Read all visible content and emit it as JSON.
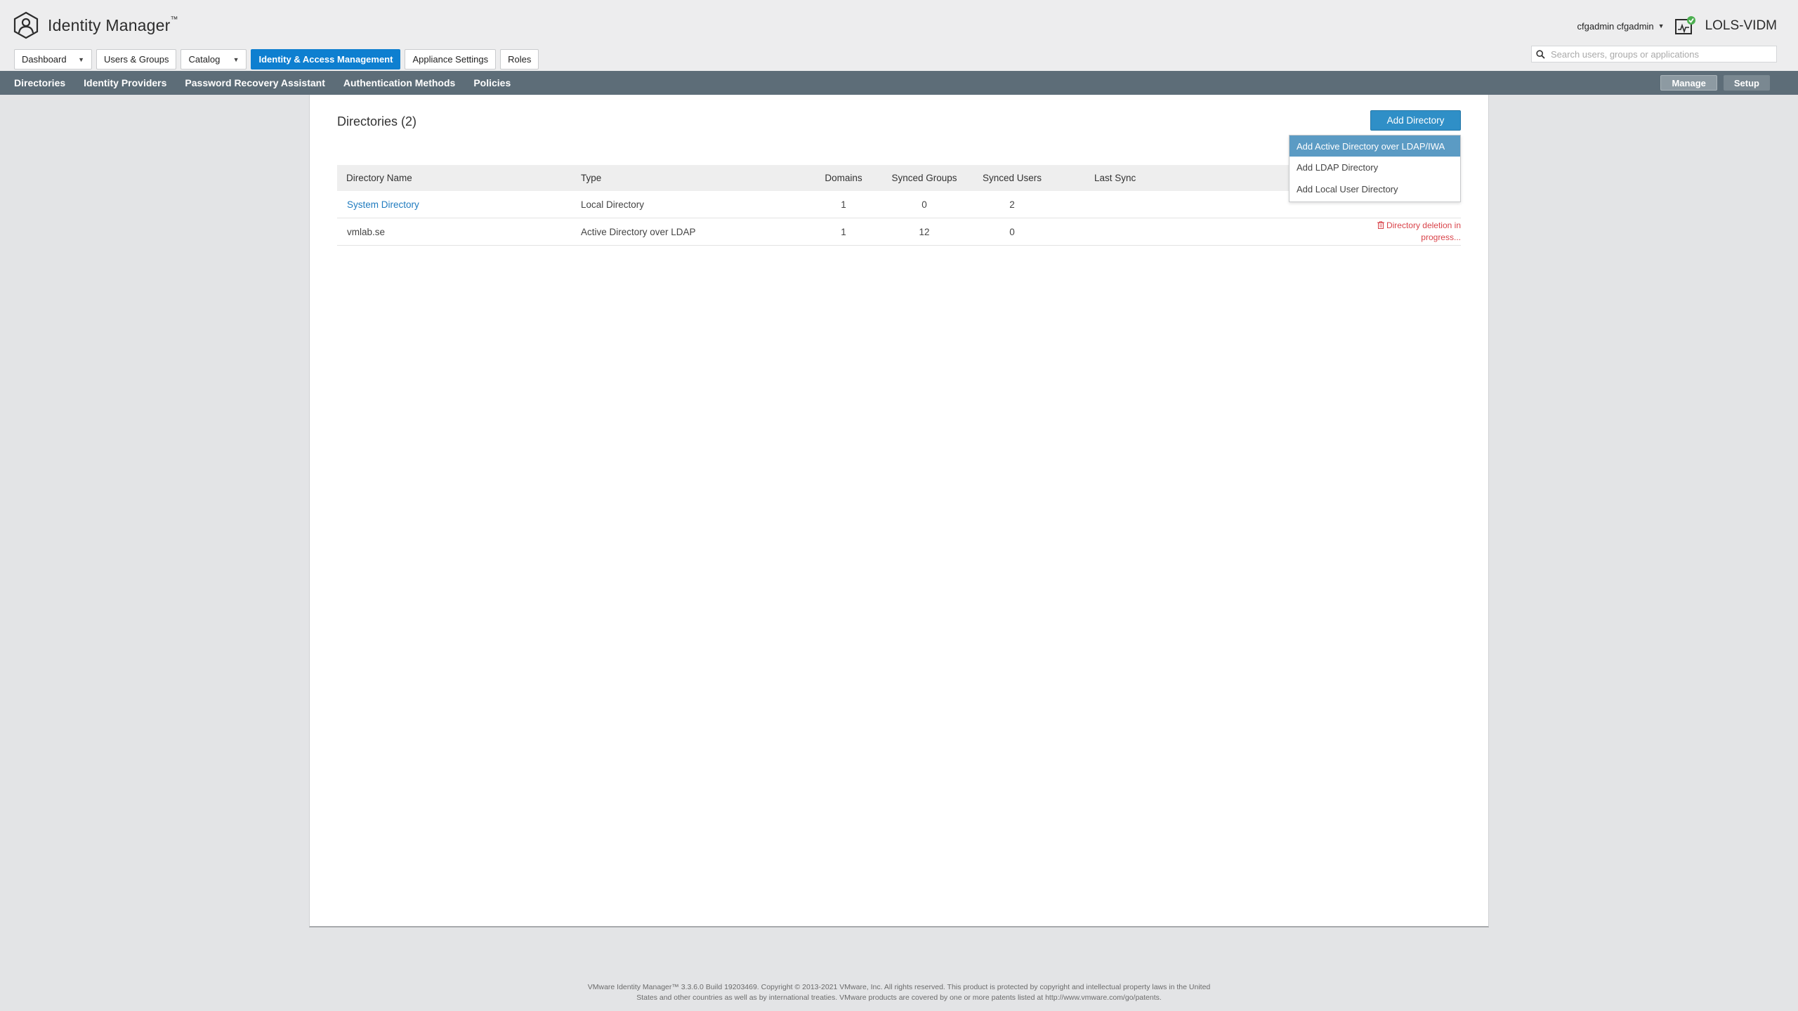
{
  "app": {
    "title": "Identity Manager",
    "trademark": "™",
    "user": "cfgadmin cfgadmin",
    "tenant": "LOLS-VIDM"
  },
  "tabs": [
    {
      "label": "Dashboard",
      "dropdown": true,
      "active": false
    },
    {
      "label": "Users & Groups",
      "dropdown": false,
      "active": false
    },
    {
      "label": "Catalog",
      "dropdown": true,
      "active": false
    },
    {
      "label": "Identity & Access Management",
      "dropdown": false,
      "active": true
    },
    {
      "label": "Appliance Settings",
      "dropdown": false,
      "active": false
    },
    {
      "label": "Roles",
      "dropdown": false,
      "active": false
    }
  ],
  "search": {
    "placeholder": "Search users, groups or applications",
    "value": ""
  },
  "subnav": {
    "items": [
      "Directories",
      "Identity Providers",
      "Password Recovery Assistant",
      "Authentication Methods",
      "Policies"
    ],
    "right": [
      {
        "label": "Manage",
        "active": true
      },
      {
        "label": "Setup",
        "active": false
      }
    ]
  },
  "main": {
    "title": "Directories (2)",
    "add_button": "Add Directory",
    "dropdown": [
      "Add Active Directory over LDAP/IWA",
      "Add LDAP Directory",
      "Add Local User Directory"
    ],
    "table": {
      "headers": [
        "Directory Name",
        "Type",
        "Domains",
        "Synced Groups",
        "Synced Users",
        "Last Sync"
      ],
      "rows": [
        {
          "name": "System Directory",
          "type": "Local Directory",
          "domains": "1",
          "groups": "0",
          "users": "2",
          "last_sync": "",
          "status_line1": "",
          "status_line2": ""
        },
        {
          "name": "vmlab.se",
          "type": "Active Directory over LDAP",
          "domains": "1",
          "groups": "12",
          "users": "0",
          "last_sync": "",
          "status_line1": "Directory deletion in",
          "status_line2": "progress..."
        }
      ]
    }
  },
  "footer": {
    "line1": "VMware Identity Manager™ 3.3.6.0 Build 19203469. Copyright © 2013-2021 VMware, Inc. All rights reserved. This product is protected by copyright and intellectual property laws in the United",
    "line2": "States and other countries as well as by international treaties. VMware products are covered by one or more patents listed at http://www.vmware.com/go/patents."
  },
  "colors": {
    "accent": "#0e7fd0",
    "subnav": "#5d6d78",
    "link": "#1f7bbf",
    "danger": "#d9434a",
    "status_ok": "#4caf50"
  }
}
